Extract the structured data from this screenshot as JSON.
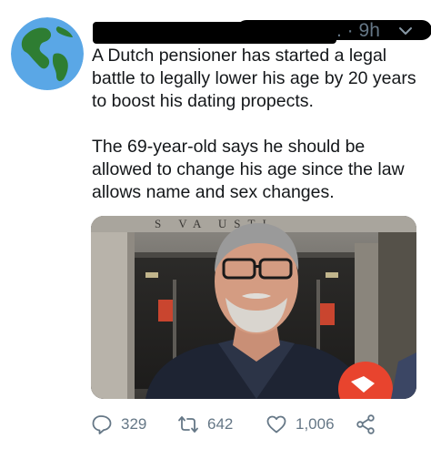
{
  "tweet": {
    "timestamp": "9h",
    "ellipsis": ". ·",
    "text_paragraphs": [
      "A Dutch pensioner has started a legal battle to legally lower his age by 20 years to boost his dating propects.",
      "The 69-year-old says he should be allowed to change his age since the law allows name and sex changes."
    ],
    "media": {
      "building_lettering": "S   VA   USTI"
    },
    "actions": {
      "reply_count": "329",
      "retweet_count": "642",
      "like_count": "1,006"
    },
    "colors": {
      "text": "#14171a",
      "muted": "#657786",
      "redaction": "#000000"
    },
    "icons": [
      "globe-avatar-icon",
      "chevron-down-icon",
      "reply-icon",
      "retweet-icon",
      "like-icon",
      "share-icon"
    ]
  }
}
